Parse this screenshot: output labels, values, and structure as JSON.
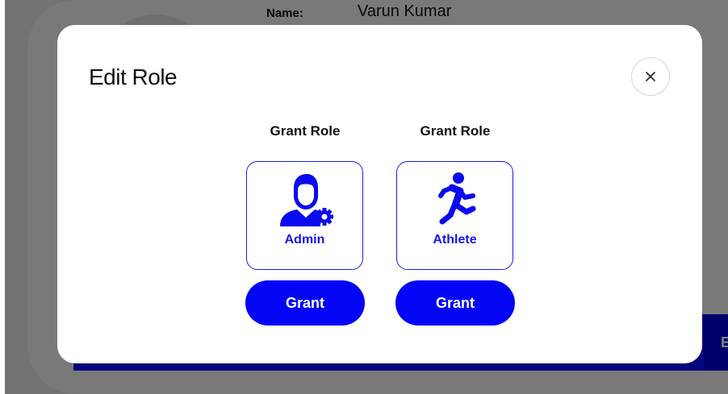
{
  "background": {
    "name_label": "Name:",
    "name_value": "Varun Kumar",
    "table_bar_letter": "E"
  },
  "modal": {
    "title": "Edit Role",
    "close_icon": "close-icon",
    "roles": [
      {
        "heading": "Grant Role",
        "name": "Admin",
        "icon": "user-gear-icon",
        "button_label": "Grant"
      },
      {
        "heading": "Grant Role",
        "name": "Athlete",
        "icon": "running-person-icon",
        "button_label": "Grant"
      }
    ]
  },
  "colors": {
    "accent": "#0505f5",
    "card_border": "#1a1aff",
    "role_text": "#1414ee",
    "overlay": "rgba(0,0,0,0.5)"
  }
}
